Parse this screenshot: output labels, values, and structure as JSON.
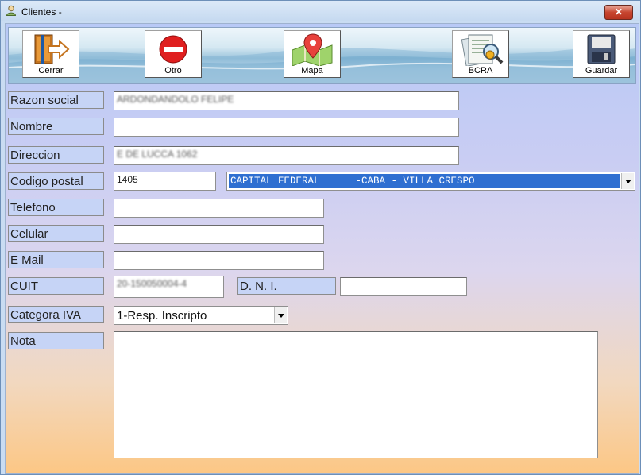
{
  "window": {
    "title": "Clientes -",
    "close_label": "✕"
  },
  "toolbar": {
    "buttons": [
      {
        "label": "Cerrar",
        "icon": "exit-door-icon"
      },
      {
        "label": "Otro",
        "icon": "no-entry-icon"
      },
      {
        "label": "Mapa",
        "icon": "map-pin-icon"
      },
      {
        "label": "BCRA",
        "icon": "documents-search-icon"
      },
      {
        "label": "Guardar",
        "icon": "floppy-disk-icon"
      }
    ]
  },
  "form": {
    "razon_social": {
      "label": "Razon social",
      "value": "ARDONDANDOLO FELIPE"
    },
    "nombre": {
      "label": "Nombre",
      "value": ""
    },
    "direccion": {
      "label": "Direccion",
      "value": "E DE LUCCA 1062"
    },
    "codigo_postal": {
      "label": "Codigo postal",
      "value": "1405",
      "locality": "CAPITAL FEDERAL      -CABA - VILLA CRESPO"
    },
    "telefono": {
      "label": "Telefono",
      "value": ""
    },
    "celular": {
      "label": "Celular",
      "value": ""
    },
    "email": {
      "label": "E Mail",
      "value": ""
    },
    "cuit": {
      "label": "CUIT",
      "value": "20-150050004-4"
    },
    "dni": {
      "label": "D. N. I.",
      "value": ""
    },
    "categoria_iva": {
      "label": "Categora IVA",
      "value": "1-Resp. Inscripto"
    },
    "nota": {
      "label": "Nota",
      "value": ""
    }
  }
}
